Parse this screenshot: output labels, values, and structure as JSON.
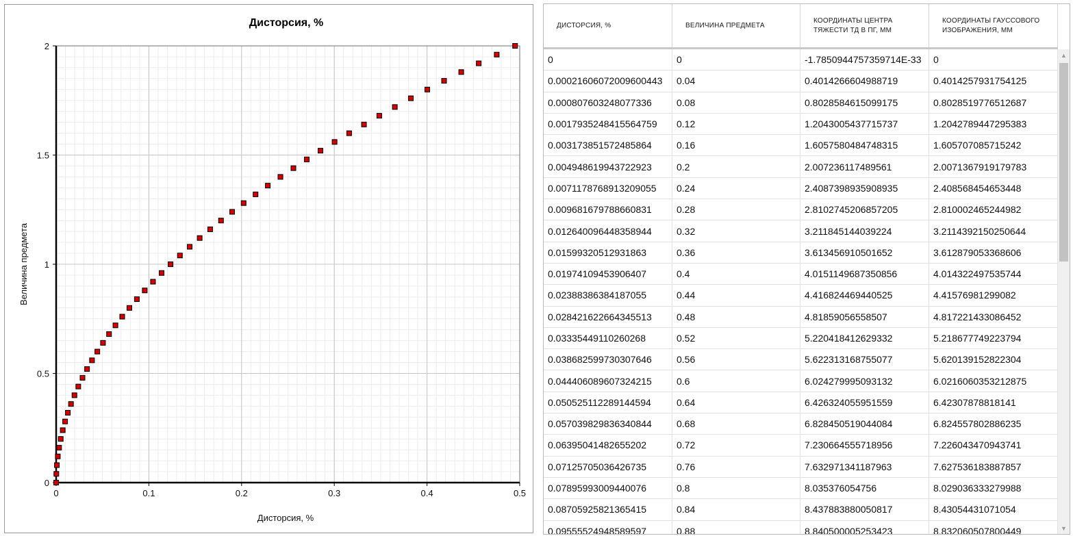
{
  "chart_data": {
    "type": "scatter",
    "title": "Дисторсия, %",
    "xlabel": "Дисторсия, %",
    "ylabel": "Величина предмета",
    "xlim": [
      0,
      0.5
    ],
    "ylim": [
      0,
      2
    ],
    "xticks": [
      0,
      0.1,
      0.2,
      0.3,
      0.4,
      0.5
    ],
    "xtick_labels": [
      "0",
      "0.1",
      "0.2",
      "0.3",
      "0.4",
      "0.5"
    ],
    "yticks": [
      0,
      0.5,
      1,
      1.5,
      2
    ],
    "ytick_labels": [
      "0",
      "0.5",
      "1",
      "1.5",
      "2"
    ],
    "grid": true,
    "marker_color": "#d40000",
    "points": [
      [
        0,
        0
      ],
      [
        0.000216,
        0.04
      ],
      [
        0.000808,
        0.08
      ],
      [
        0.001794,
        0.12
      ],
      [
        0.003174,
        0.16
      ],
      [
        0.004949,
        0.2
      ],
      [
        0.007118,
        0.24
      ],
      [
        0.009682,
        0.28
      ],
      [
        0.01264,
        0.32
      ],
      [
        0.015993,
        0.36
      ],
      [
        0.019741,
        0.4
      ],
      [
        0.023884,
        0.44
      ],
      [
        0.028422,
        0.48
      ],
      [
        0.033354,
        0.52
      ],
      [
        0.038683,
        0.56
      ],
      [
        0.044406,
        0.6
      ],
      [
        0.050525,
        0.64
      ],
      [
        0.05704,
        0.68
      ],
      [
        0.06395,
        0.72
      ],
      [
        0.071257,
        0.76
      ],
      [
        0.07896,
        0.8
      ],
      [
        0.087059,
        0.84
      ],
      [
        0.095555,
        0.88
      ],
      [
        0.10445,
        0.92
      ],
      [
        0.11374,
        0.96
      ],
      [
        0.12342,
        1.0
      ],
      [
        0.1335,
        1.04
      ],
      [
        0.144,
        1.08
      ],
      [
        0.1548,
        1.12
      ],
      [
        0.1661,
        1.16
      ],
      [
        0.1778,
        1.2
      ],
      [
        0.1898,
        1.24
      ],
      [
        0.2022,
        1.28
      ],
      [
        0.2151,
        1.32
      ],
      [
        0.2283,
        1.36
      ],
      [
        0.2419,
        1.4
      ],
      [
        0.2559,
        1.44
      ],
      [
        0.2703,
        1.48
      ],
      [
        0.2851,
        1.52
      ],
      [
        0.3003,
        1.56
      ],
      [
        0.316,
        1.6
      ],
      [
        0.332,
        1.64
      ],
      [
        0.3485,
        1.68
      ],
      [
        0.3653,
        1.72
      ],
      [
        0.3826,
        1.76
      ],
      [
        0.4003,
        1.8
      ],
      [
        0.4184,
        1.84
      ],
      [
        0.4369,
        1.88
      ],
      [
        0.4558,
        1.92
      ],
      [
        0.4752,
        1.96
      ],
      [
        0.495,
        2.0
      ]
    ]
  },
  "table": {
    "headers": [
      "ДИСТОРСИЯ, %",
      "ВЕЛИЧИНА ПРЕДМЕТА",
      "КООРДИНАТЫ ЦЕНТРА ТЯЖЕСТИ ТД В ПГ, ММ",
      "КООРДИНАТЫ ГАУССОВОГО ИЗОБРАЖЕНИЯ, ММ"
    ],
    "rows": [
      [
        "0",
        "0",
        "-1.7850944757359714E-33",
        "0"
      ],
      [
        "0.00021606072009600443",
        "0.04",
        "0.4014266604988719",
        "0.4014257931754125"
      ],
      [
        "0.000807603248077336",
        "0.08",
        "0.8028584615099175",
        "0.8028519776512687"
      ],
      [
        "0.0017935248415564759",
        "0.12",
        "1.2043005437715737",
        "1.2042789447295383"
      ],
      [
        "0.003173851572485864",
        "0.16",
        "1.6057580484748315",
        "1.605707085715242"
      ],
      [
        "0.004948619943722923",
        "0.2",
        "2.007236117489561",
        "2.0071367919179783"
      ],
      [
        "0.007117876891320905​5",
        "0.24",
        "2.4087398935908935",
        "2.408568454653448"
      ],
      [
        "0.009681679788660831",
        "0.28",
        "2.8102745206857205",
        "2.810002465244982"
      ],
      [
        "0.012640096448358944",
        "0.32",
        "3.211845144039224",
        "3.211439215025064​4"
      ],
      [
        "0.01599320512931863",
        "0.36",
        "3.613456910501652",
        "3.612879053368606"
      ],
      [
        "0.01974109453906407",
        "0.4",
        "4.0151149687350856",
        "4.014322497535744"
      ],
      [
        "0.02388386384187055",
        "0.44",
        "4.416824469440525",
        "4.41576981299082"
      ],
      [
        "0.028421622664345513",
        "0.48",
        "4.81859056558507",
        "4.817221433086452"
      ],
      [
        "0.03335449110260268",
        "0.52",
        "5.220418412629332",
        "5.218677749223794"
      ],
      [
        "0.038682599730307646",
        "0.56",
        "5.622313168755077",
        "5.620139152822304"
      ],
      [
        "0.044406089607324215",
        "0.6",
        "6.024279995093132",
        "6.0216060353212875"
      ],
      [
        "0.050525112289144594",
        "0.64",
        "6.426324055951559",
        "6.42307878818141"
      ],
      [
        "0.057039829836340844",
        "0.68",
        "6.828450519044084",
        "6.824557802886235"
      ],
      [
        "0.06395041482655202",
        "0.72",
        "7.230664555718956",
        "7.226043470943741"
      ],
      [
        "0.07125705036426735",
        "0.76",
        "7.632971341187963",
        "7.627536183887857"
      ],
      [
        "0.07895993009440076",
        "0.8",
        "8.035376054756",
        "8.029036333279988"
      ],
      [
        "0.08705925821365415",
        "0.84",
        "8.437883880050817",
        "8.43054431071054"
      ],
      [
        "0.09555524948589597",
        "0.88",
        "8.840500005253423",
        "8.832060507800449"
      ]
    ]
  }
}
